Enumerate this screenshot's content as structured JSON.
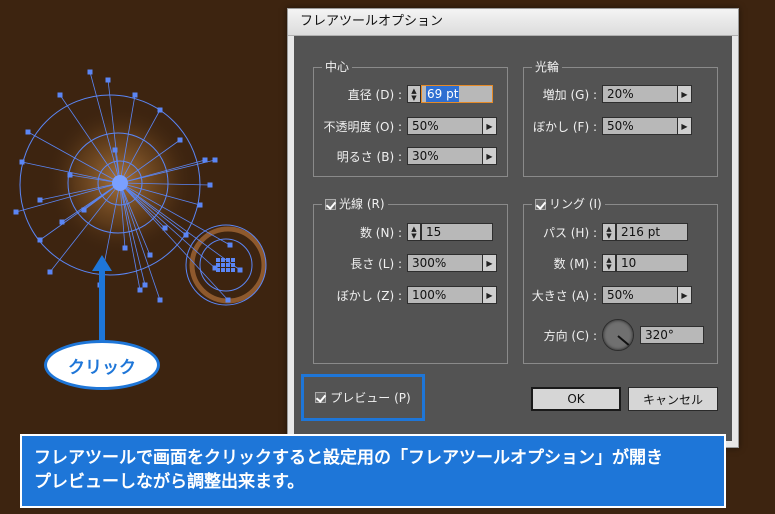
{
  "dialog": {
    "title": "フレアツールオプション",
    "center": {
      "title": "中心",
      "diameter_label": "直径 (D) :",
      "diameter_value": "69 pt",
      "opacity_label": "不透明度 (O) :",
      "opacity_value": "50%",
      "brightness_label": "明るさ (B) :",
      "brightness_value": "30%"
    },
    "halo": {
      "title": "光輪",
      "growth_label": "増加 (G) :",
      "growth_value": "20%",
      "fuzziness_label": "ぼかし (F) :",
      "fuzziness_value": "50%"
    },
    "rays": {
      "title": "光線 (R)",
      "checked": true,
      "number_label": "数 (N) :",
      "number_value": "15",
      "longest_label": "長さ (L) :",
      "longest_value": "300%",
      "fuzziness_label": "ぼかし (Z) :",
      "fuzziness_value": "100%"
    },
    "rings": {
      "title": "リング (I)",
      "checked": true,
      "path_label": "パス (H) :",
      "path_value": "216 pt",
      "number_label": "数 (M) :",
      "number_value": "10",
      "largest_label": "大きさ (A) :",
      "largest_value": "50%",
      "direction_label": "方向 (C) :",
      "direction_value": "320°"
    },
    "preview_label": "プレビュー (P)",
    "preview_checked": true,
    "ok_label": "OK",
    "cancel_label": "キャンセル"
  },
  "annotations": {
    "click_label": "クリック",
    "caption_line1": "フレアツールで画面をクリックすると設定用の「フレアツールオプション」が開き",
    "caption_line2": "プレビューしながら調整出来ます。",
    "accent_color": "#1e76d8"
  },
  "canvas": {
    "background_color": "#3d2410",
    "flare_color": "#4d7df0"
  }
}
